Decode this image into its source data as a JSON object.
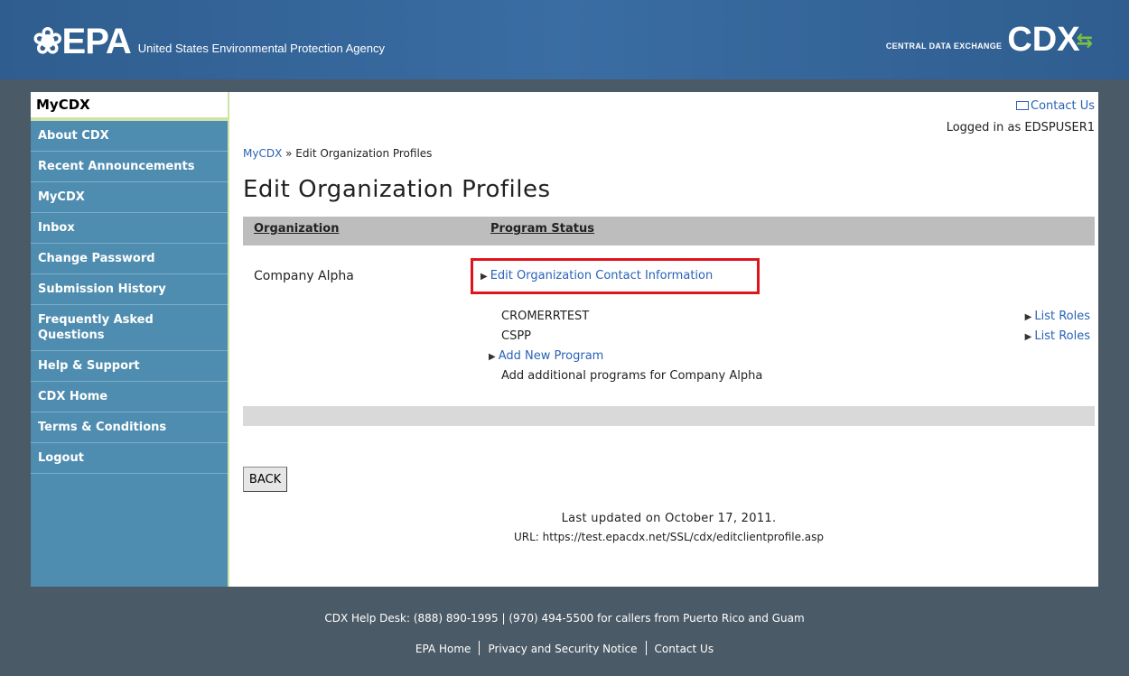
{
  "header": {
    "epa_mark": "❀EPA",
    "agency": "United States Environmental Protection Agency",
    "cdx_sub": "CENTRAL DATA EXCHANGE",
    "cdx_word": "CDX"
  },
  "sidebar": {
    "title": "MyCDX",
    "items": [
      {
        "label": "About CDX"
      },
      {
        "label": "Recent Announcements"
      },
      {
        "label": "MyCDX"
      },
      {
        "label": "Inbox"
      },
      {
        "label": "Change Password"
      },
      {
        "label": "Submission History"
      },
      {
        "label": "Frequently Asked Questions"
      },
      {
        "label": "Help & Support"
      },
      {
        "label": "CDX Home"
      },
      {
        "label": "Terms & Conditions"
      },
      {
        "label": "Logout"
      }
    ]
  },
  "main": {
    "contact_us": "Contact Us",
    "logged_in": "Logged in as EDSPUSER1",
    "breadcrumb": {
      "root": "MyCDX",
      "sep": " » ",
      "current": "Edit Organization Profiles"
    },
    "title": "Edit Organization Profiles",
    "table": {
      "col_org": "Organization",
      "col_status": "Program Status",
      "org_name": "Company Alpha",
      "edit_contact": "Edit Organization Contact Information",
      "programs": [
        {
          "name": "CROMERRTEST",
          "action": "List Roles"
        },
        {
          "name": "CSPP",
          "action": "List Roles"
        }
      ],
      "add_program": "Add New Program",
      "add_desc": "Add additional programs for Company Alpha"
    },
    "back_label": "BACK",
    "last_updated": "Last updated on October 17, 2011.",
    "url_line": "URL: https://test.epacdx.net/SSL/cdx/editclientprofile.asp"
  },
  "footer": {
    "help": "CDX Help Desk: (888) 890-1995 | (970) 494-5500 for callers from Puerto Rico and Guam",
    "links": [
      "EPA Home",
      "Privacy and Security Notice",
      "Contact Us"
    ]
  },
  "colors": {
    "banner": "#2f5d8f",
    "sidebar": "#4f8db0",
    "link": "#2a62b8",
    "highlight": "#e0141c"
  },
  "icons": {
    "epa": "epa-flower-icon",
    "cdx": "cdx-arrows-icon",
    "mail": "envelope-icon",
    "triangle": "triangle-right-icon"
  }
}
